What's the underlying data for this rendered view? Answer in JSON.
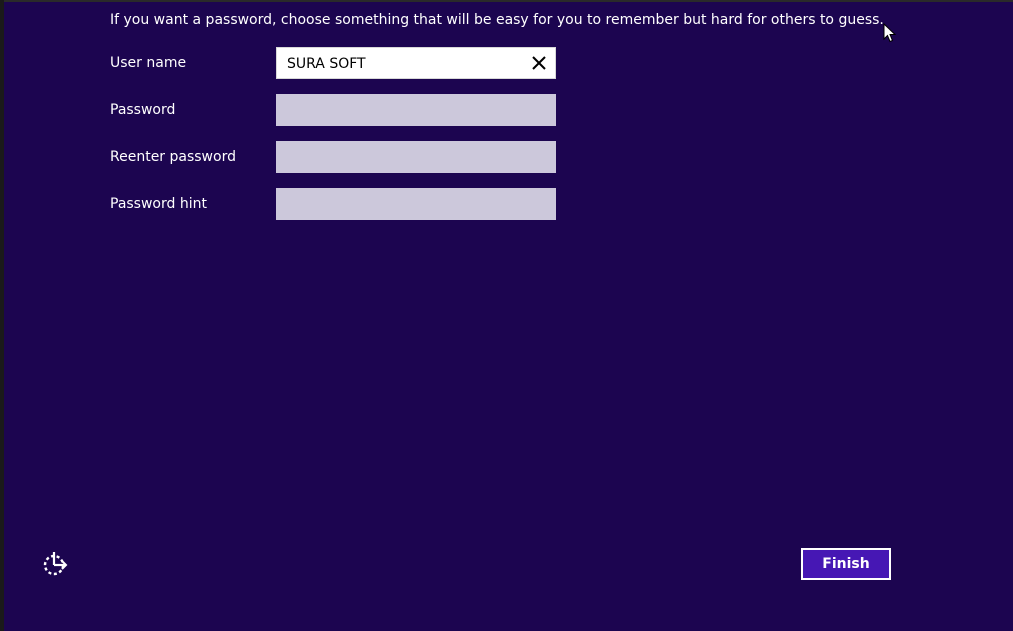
{
  "instruction": "If you want a password, choose something that will be easy for you to remember but hard for others to guess.",
  "form": {
    "user_name_label": "User name",
    "user_name_value": "SURA SOFT",
    "password_label": "Password",
    "password_value": "",
    "reenter_label": "Reenter password",
    "reenter_value": "",
    "hint_label": "Password hint",
    "hint_value": ""
  },
  "buttons": {
    "finish_label": "Finish"
  },
  "icons": {
    "clear": "close-icon",
    "ease_of_access": "ease-of-access-icon",
    "pointer": "mouse-cursor-icon"
  },
  "colors": {
    "background": "#1c0550",
    "field_inactive": "#ccc8db",
    "field_active": "#ffffff",
    "finish_button": "#4617b4",
    "text": "#ffffff"
  }
}
